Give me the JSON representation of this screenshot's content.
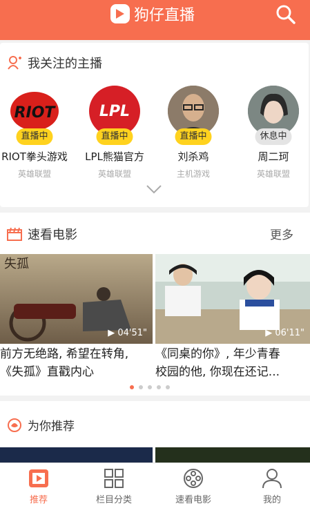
{
  "header": {
    "title": "狗仔直播"
  },
  "follows": {
    "title": "我关注的主播",
    "streamers": [
      {
        "name": "RIOT拳头游戏",
        "category": "英雄联盟",
        "status": "直播中",
        "avatar_text": "RIOT"
      },
      {
        "name": "LPL熊猫官方",
        "category": "英雄联盟",
        "status": "直播中",
        "avatar_text": "LPL"
      },
      {
        "name": "刘杀鸡",
        "category": "主机游戏",
        "status": "直播中"
      },
      {
        "name": "周二珂",
        "category": "英雄联盟",
        "status": "休息中"
      }
    ]
  },
  "movies": {
    "title": "速看电影",
    "more": "更多",
    "items": [
      {
        "poster_text": "失孤",
        "duration": "▶ 04'51\"",
        "caption_line1": "前方无绝路, 希望在转角,",
        "caption_line2": "《失孤》直戳内心"
      },
      {
        "duration": "▶ 06'11\"",
        "caption_line1": "《同桌的你》, 年少青春",
        "caption_line2": "校园的他, 你现在还记..."
      }
    ],
    "carousel": {
      "count": 5,
      "active": 1
    }
  },
  "recommend": {
    "title": "为你推荐"
  },
  "tabs": [
    {
      "label": "推荐",
      "active": true
    },
    {
      "label": "栏目分类",
      "active": false
    },
    {
      "label": "速看电影",
      "active": false
    },
    {
      "label": "我的",
      "active": false
    }
  ],
  "colors": {
    "accent": "#f76e4f",
    "badge_live": "#ffd21e",
    "badge_off": "#e4e4e4"
  }
}
